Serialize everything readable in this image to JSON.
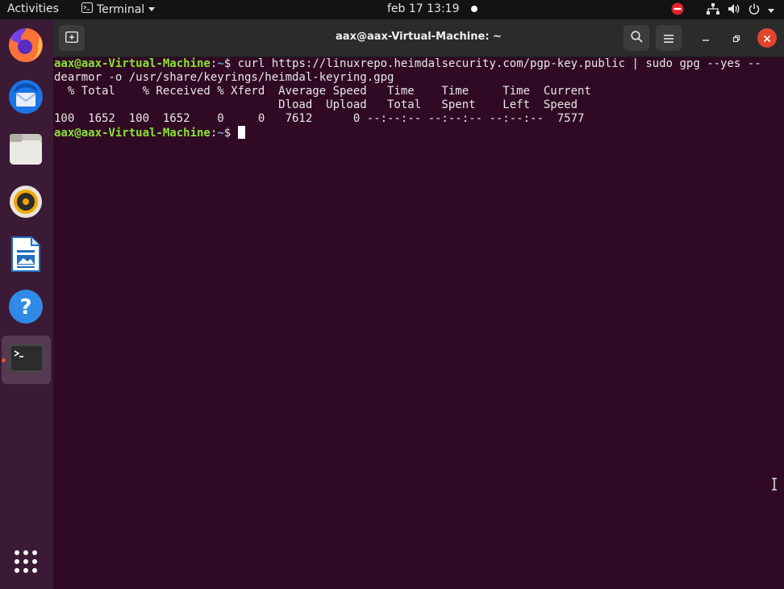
{
  "topbar": {
    "activities": "Activities",
    "app_name": "Terminal",
    "datetime": "feb 17  13:19"
  },
  "dock": {
    "items": [
      {
        "name": "Firefox",
        "icon": "firefox-icon"
      },
      {
        "name": "Thunderbird",
        "icon": "thunderbird-icon"
      },
      {
        "name": "Files",
        "icon": "files-icon"
      },
      {
        "name": "Rhythmbox",
        "icon": "rhythmbox-icon"
      },
      {
        "name": "LibreOffice Writer",
        "icon": "writer-icon"
      },
      {
        "name": "Help",
        "icon": "help-icon"
      },
      {
        "name": "Terminal",
        "icon": "terminal-icon",
        "active": true
      }
    ],
    "apps_grid_icon": "apps-grid-icon"
  },
  "window": {
    "title": "aax@aax-Virtual-Machine: ~"
  },
  "terminal": {
    "prompt_user": "aax@aax-Virtual-Machine",
    "prompt_path": "~",
    "prompt_symbol": "$",
    "command_line1": " curl https://linuxrepo.heimdalsecurity.com/pgp-key.public | sudo gpg --yes --",
    "command_line2": "dearmor -o /usr/share/keyrings/heimdal-keyring.gpg",
    "output": [
      "  % Total    % Received % Xferd  Average Speed   Time    Time     Time  Current",
      "                                 Dload  Upload   Total   Spent    Left  Speed",
      "100  1652  100  1652    0     0   7612      0 --:--:-- --:--:-- --:--:--  7577"
    ]
  },
  "colors": {
    "terminal_bg": "#300a24",
    "prompt_user": "#8ae234",
    "prompt_path": "#729fcf",
    "accent": "#e95420"
  }
}
